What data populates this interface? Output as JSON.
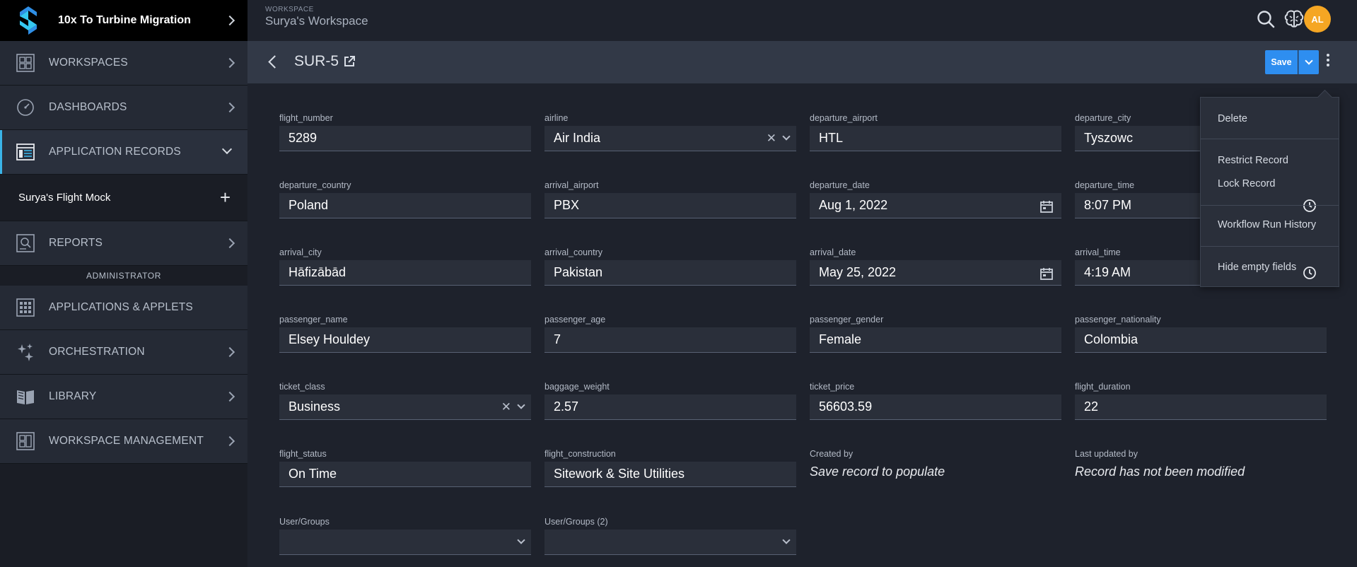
{
  "app": {
    "title": "10x To Turbine Migration"
  },
  "sidebar": {
    "items": [
      {
        "label": "WORKSPACES",
        "icon": "workspaces-grid-icon"
      },
      {
        "label": "DASHBOARDS",
        "icon": "gauge-icon"
      },
      {
        "label": "APPLICATION RECORDS",
        "icon": "records-icon"
      },
      {
        "label": "REPORTS",
        "icon": "reports-icon"
      },
      {
        "label": "APPLICATIONS & APPLETS",
        "icon": "apps-grid-icon"
      },
      {
        "label": "ORCHESTRATION",
        "icon": "sparkle-icon"
      },
      {
        "label": "LIBRARY",
        "icon": "book-icon"
      },
      {
        "label": "WORKSPACE MANAGEMENT",
        "icon": "layout-icon"
      }
    ],
    "sub_item": {
      "label": "Surya's Flight Mock"
    },
    "admin_header": "ADMINISTRATOR"
  },
  "topbar": {
    "workspace_small": "WORKSPACE",
    "workspace_name": "Surya's Workspace",
    "avatar_initials": "AL"
  },
  "record": {
    "title": "SUR-5",
    "save_label": "Save"
  },
  "fields": {
    "flight_number": {
      "label": "flight_number",
      "value": "5289"
    },
    "airline": {
      "label": "airline",
      "value": "Air India"
    },
    "departure_airport": {
      "label": "departure_airport",
      "value": "HTL"
    },
    "departure_city": {
      "label": "departure_city",
      "value": "Tyszowc"
    },
    "departure_country": {
      "label": "departure_country",
      "value": "Poland"
    },
    "arrival_airport": {
      "label": "arrival_airport",
      "value": "PBX"
    },
    "departure_date": {
      "label": "departure_date",
      "value": "Aug 1, 2022"
    },
    "departure_time": {
      "label": "departure_time",
      "value": "8:07 PM"
    },
    "arrival_city": {
      "label": "arrival_city",
      "value": "Hāfizābād"
    },
    "arrival_country": {
      "label": "arrival_country",
      "value": "Pakistan"
    },
    "arrival_date": {
      "label": "arrival_date",
      "value": "May 25, 2022"
    },
    "arrival_time": {
      "label": "arrival_time",
      "value": "4:19 AM"
    },
    "passenger_name": {
      "label": "passenger_name",
      "value": "Elsey Houldey"
    },
    "passenger_age": {
      "label": "passenger_age",
      "value": "7"
    },
    "passenger_gender": {
      "label": "passenger_gender",
      "value": "Female"
    },
    "passenger_nationality": {
      "label": "passenger_nationality",
      "value": "Colombia"
    },
    "ticket_class": {
      "label": "ticket_class",
      "value": "Business"
    },
    "baggage_weight": {
      "label": "baggage_weight",
      "value": "2.57"
    },
    "ticket_price": {
      "label": "ticket_price",
      "value": "56603.59"
    },
    "flight_duration": {
      "label": "flight_duration",
      "value": "22"
    },
    "flight_status": {
      "label": "flight_status",
      "value": "On Time"
    },
    "flight_construction": {
      "label": "flight_construction",
      "value": "Sitework & Site Utilities"
    },
    "created_by": {
      "label": "Created by",
      "value": "Save record to populate"
    },
    "last_updated_by": {
      "label": "Last updated by",
      "value": "Record has not been modified"
    },
    "user_groups": {
      "label": "User/Groups",
      "value": ""
    },
    "user_groups_2": {
      "label": "User/Groups (2)",
      "value": ""
    }
  },
  "menu": {
    "delete": "Delete",
    "restrict_record": "Restrict Record",
    "lock_record": "Lock Record",
    "workflow_run_history": "Workflow Run History",
    "hide_empty_fields": "Hide empty fields"
  },
  "colors": {
    "accent": "#3ab4e8",
    "save_button": "#2e8ef0",
    "avatar": "#f5a623"
  }
}
